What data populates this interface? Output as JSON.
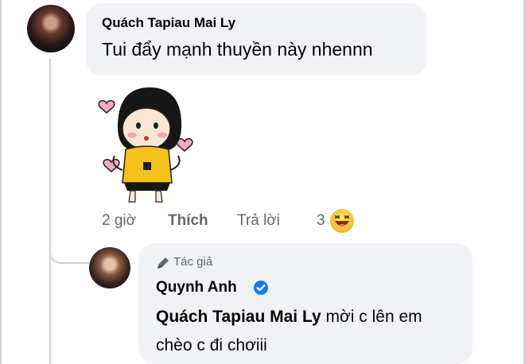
{
  "comment": {
    "author": "Quách Tapiau Mai Ly",
    "text": "Tui đẩy mạnh thuyền này nhennn",
    "sticker": "girl-hearts-sticker",
    "actions": {
      "time": "2 giờ",
      "like": "Thích",
      "reply": "Trả lời",
      "reaction_count": "3",
      "reaction_icon": "laughing-emoji"
    }
  },
  "reply": {
    "badge": "Tác giả",
    "author": "Quynh Anh",
    "verified": true,
    "mention": "Quách Tapiau Mai Ly",
    "text": " mời c lên em chèo c đi chơiii"
  },
  "colors": {
    "bubble": "#f0f2f5",
    "secondary_text": "#65676b",
    "verified_blue": "#1877f2",
    "thread_line": "#ced0d4"
  }
}
